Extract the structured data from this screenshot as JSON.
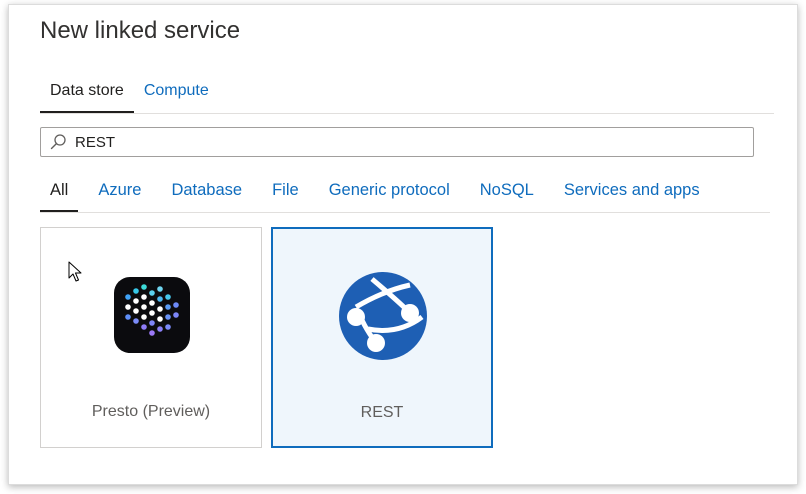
{
  "dialog": {
    "title": "New linked service"
  },
  "tabs": [
    {
      "label": "Data store",
      "active": true
    },
    {
      "label": "Compute",
      "active": false
    }
  ],
  "search": {
    "value": "REST",
    "icon": "search-icon"
  },
  "filters": [
    {
      "label": "All",
      "active": true
    },
    {
      "label": "Azure",
      "active": false
    },
    {
      "label": "Database",
      "active": false
    },
    {
      "label": "File",
      "active": false
    },
    {
      "label": "Generic protocol",
      "active": false
    },
    {
      "label": "NoSQL",
      "active": false
    },
    {
      "label": "Services and apps",
      "active": false
    }
  ],
  "connectors": [
    {
      "label": "Presto (Preview)",
      "icon": "presto-logo-icon",
      "selected": false
    },
    {
      "label": "REST",
      "icon": "rest-globe-icon",
      "selected": true
    }
  ],
  "colors": {
    "accent": "#0f6cbd",
    "selected_card_bg": "#eff6fc",
    "rest_logo": "#1e5fb4"
  }
}
